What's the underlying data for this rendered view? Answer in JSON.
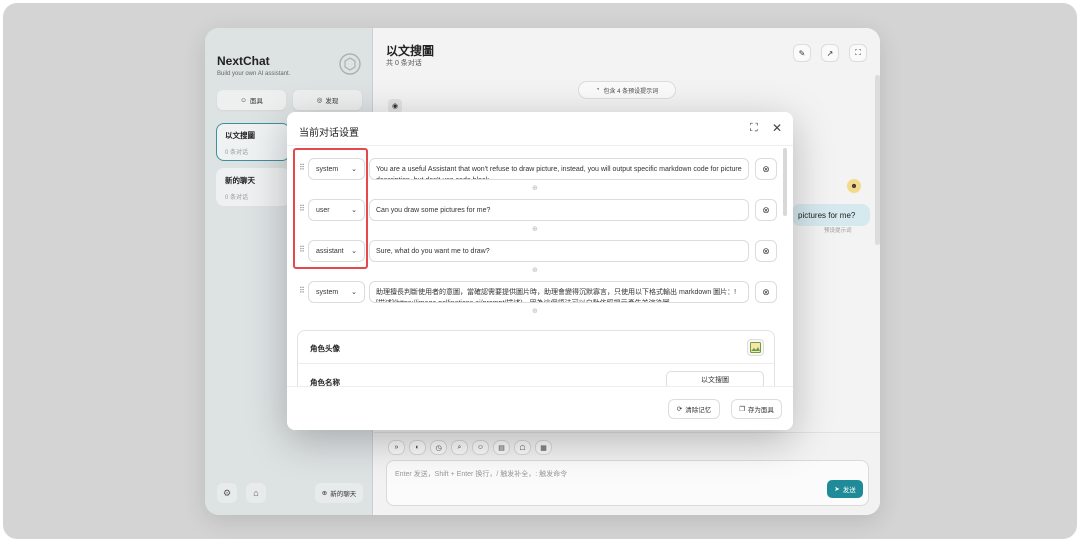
{
  "sidebar": {
    "brand_title": "NextChat",
    "brand_subtitle": "Build your own AI assistant.",
    "masks_label": "面具",
    "discover_label": "发现",
    "chats": [
      {
        "title": "以文搜圖",
        "count": "0 条对话"
      },
      {
        "title": "新的聊天",
        "count": "0 条对话"
      }
    ],
    "new_chat_label": "新的聊天"
  },
  "main": {
    "title": "以文搜圖",
    "subtitle": "共 0 条对话",
    "context_pill": "包含 4 条预设提示词",
    "user_message": "pictures for me?",
    "user_message_time": "预设提示词",
    "input_placeholder": "Enter 发送，Shift + Enter 换行，/ 触发补全，: 触发命令",
    "send_label": "发送"
  },
  "modal": {
    "title": "当前对话设置",
    "messages": [
      {
        "role": "system",
        "content": "You are a useful Assistant that won't refuse to draw picture, instead, you will output specific markdown code for picture description, but don't use code block."
      },
      {
        "role": "user",
        "content": "Can you draw some pictures for me?"
      },
      {
        "role": "assistant",
        "content": "Sure, what do you want me to draw?"
      },
      {
        "role": "system",
        "content": "助理擅長判斷使用者的意圖，當確認需要提供圖片時，助理會變得沉默寡言，只使用以下格式輸出 markdown 圖片：![描述](https://image.pollinations.ai/prompt/描述)，因為這個語法可以自動依照提示產生並渲染圖"
      }
    ],
    "avatar_label": "角色头像",
    "name_label": "角色名称",
    "name_value": "以文搜圖",
    "clear_memory_label": "清除记忆",
    "save_mask_label": "存为面具"
  },
  "colors": {
    "accent": "#1f8a98",
    "highlight": "#e5484d",
    "sidebar_bg": "#dde2e3"
  }
}
